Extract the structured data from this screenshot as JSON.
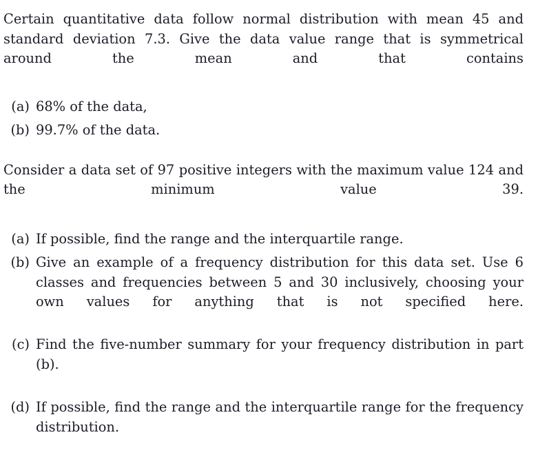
{
  "document": {
    "type": "statistics-worksheet",
    "background_color": "#ffffff",
    "text_color": "#1b1b26"
  },
  "problem_1": {
    "statement": "Certain quantitative data follow normal distribution with mean 45 and standard deviation 7.3.  Give the data value range that is symmetrical around the mean and that contains",
    "items": [
      {
        "label": "(a)",
        "text": "68% of the data,"
      },
      {
        "label": "(b)",
        "text": "99.7% of the data."
      }
    ]
  },
  "problem_2": {
    "statement": "Consider a data set of 97 positive integers with the maximum value 124 and the minimum value 39.",
    "items": [
      {
        "label": "(a)",
        "text": "If possible, find the range and the interquartile range."
      },
      {
        "label": "(b)",
        "text": "Give an example of a frequency distribution for this data set.  Use 6 classes and frequencies between 5 and 30 inclusively, choosing your own values for anything that is not specified here."
      },
      {
        "label": "(c)",
        "text": "Find the five-number summary for your frequency distribution in part (b)."
      },
      {
        "label": "(d)",
        "text": "If possible, find the range and the interquartile range for the frequency distribution."
      }
    ]
  }
}
